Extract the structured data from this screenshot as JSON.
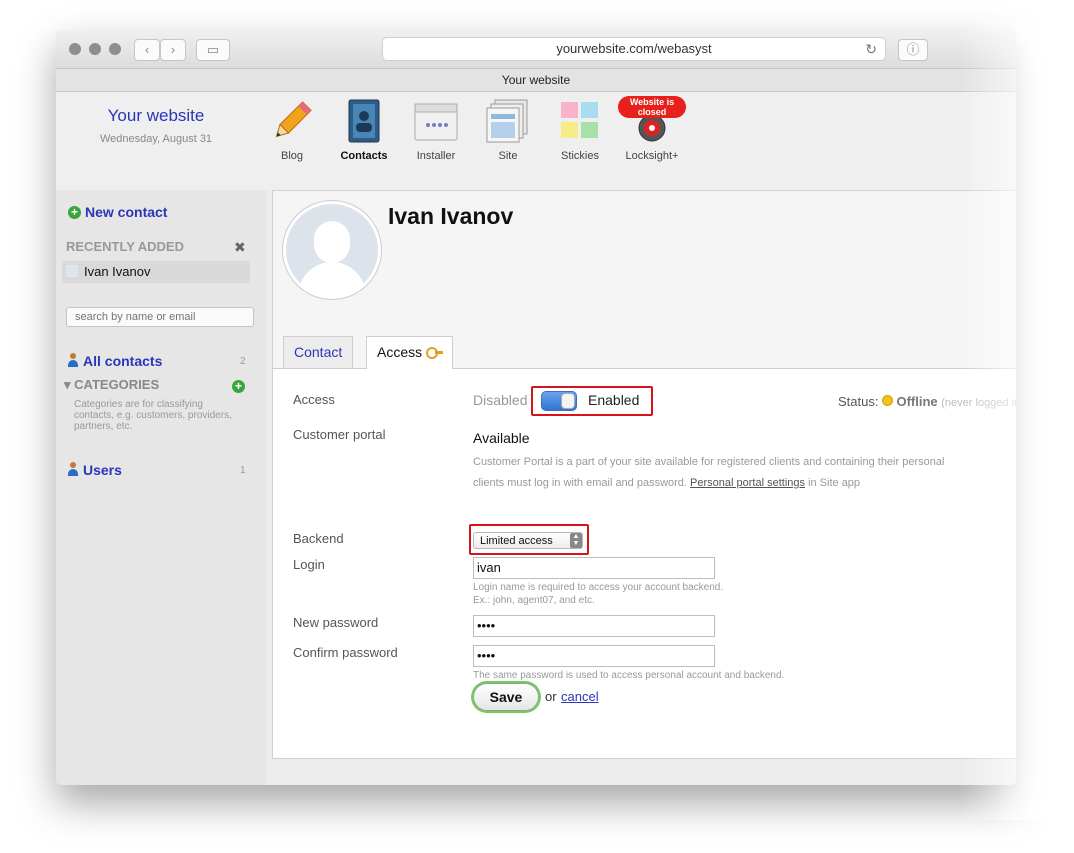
{
  "browser": {
    "url": "yourwebsite.com/webasyst",
    "title": "Your website"
  },
  "header": {
    "site_name": "Your website",
    "date": "Wednesday, August 31",
    "apps": [
      {
        "label": "Blog",
        "icon": "pencil-icon"
      },
      {
        "label": "Contacts",
        "icon": "address-book-icon",
        "active": true
      },
      {
        "label": "Installer",
        "icon": "installer-icon"
      },
      {
        "label": "Site",
        "icon": "site-pages-icon"
      },
      {
        "label": "Stickies",
        "icon": "sticky-notes-icon"
      },
      {
        "label": "Locksight+",
        "icon": "lock-icon",
        "badge": "Website is closed"
      }
    ]
  },
  "sidebar": {
    "new_contact": "New contact",
    "recently_added_title": "RECENTLY ADDED",
    "recent_items": [
      "Ivan Ivanov"
    ],
    "search_placeholder": "search by name or email",
    "all_contacts_label": "All contacts",
    "all_contacts_count": "2",
    "categories_title": "CATEGORIES",
    "categories_hint": "Categories are for classifying contacts, e.g. customers, providers, partners, etc.",
    "users_label": "Users",
    "users_count": "1"
  },
  "contact": {
    "name": "Ivan Ivanov",
    "tabs": [
      {
        "label": "Contact"
      },
      {
        "label": "Access",
        "active": true
      }
    ]
  },
  "access_form": {
    "access_label": "Access",
    "disabled_label": "Disabled",
    "enabled_label": "Enabled",
    "access_enabled": true,
    "status_label": "Status:",
    "status_value": "Offline",
    "status_note": "(never logged in)",
    "customer_portal_label": "Customer portal",
    "customer_portal_value": "Available",
    "customer_portal_desc": "Customer Portal is a part of your site available for registered clients and containing their personal",
    "customer_portal_desc2": "clients must log in with email and password.",
    "portal_settings_link": "Personal portal settings",
    "portal_settings_suffix": "in Site app",
    "backend_label": "Backend",
    "backend_value": "Limited access",
    "login_label": "Login",
    "login_value": "ivan",
    "login_hint1": "Login name is required to access your account backend.",
    "login_hint2": "Ex.: john, agent07, and etc.",
    "new_password_label": "New password",
    "new_password_value": "••••",
    "confirm_password_label": "Confirm password",
    "confirm_password_value": "••••",
    "password_hint": "The same password is used to access personal account and backend.",
    "save_label": "Save",
    "or_label": "or",
    "cancel_label": "cancel"
  },
  "colors": {
    "link": "#2a36b8",
    "highlight_box": "#d6141c",
    "save_glow": "#6fcf52",
    "status_dot": "#f2c21a"
  }
}
